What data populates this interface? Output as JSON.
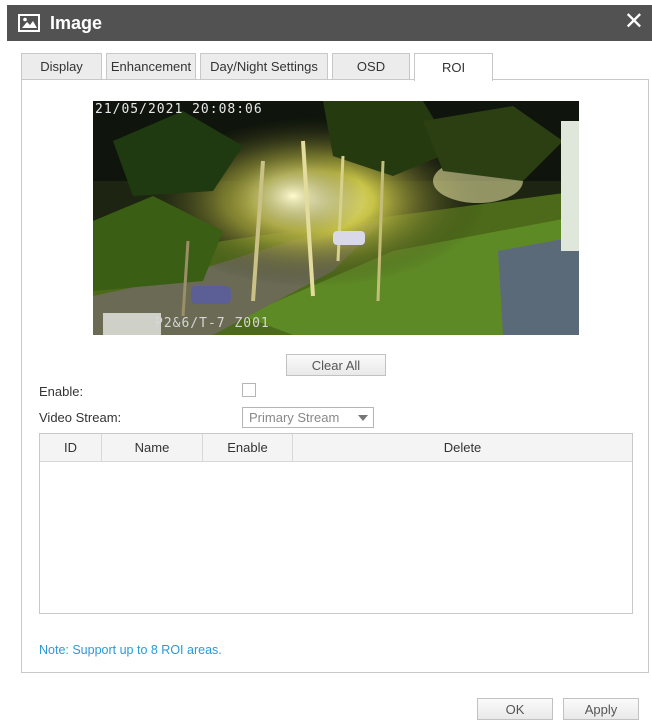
{
  "window": {
    "title": "Image",
    "icon": "image-icon",
    "close_label": "✕"
  },
  "tabs": [
    {
      "label": "Display",
      "active": false
    },
    {
      "label": "Enhancement",
      "active": false
    },
    {
      "label": "Day/Night Settings",
      "active": false
    },
    {
      "label": "OSD",
      "active": false
    },
    {
      "label": "ROI",
      "active": true
    }
  ],
  "video": {
    "osd_datetime": "21/05/2021 20:08:06",
    "osd_camera": "P2&6/T-7  Z001"
  },
  "roi": {
    "clear_all_label": "Clear All",
    "enable_label": "Enable:",
    "enable_checked": false,
    "video_stream_label": "Video Stream:",
    "video_stream_value": "Primary Stream",
    "table_headers": [
      "ID",
      "Name",
      "Enable",
      "Delete"
    ],
    "rows": [],
    "note": "Note: Support up to 8 ROI areas."
  },
  "footer": {
    "ok_label": "OK",
    "apply_label": "Apply"
  }
}
